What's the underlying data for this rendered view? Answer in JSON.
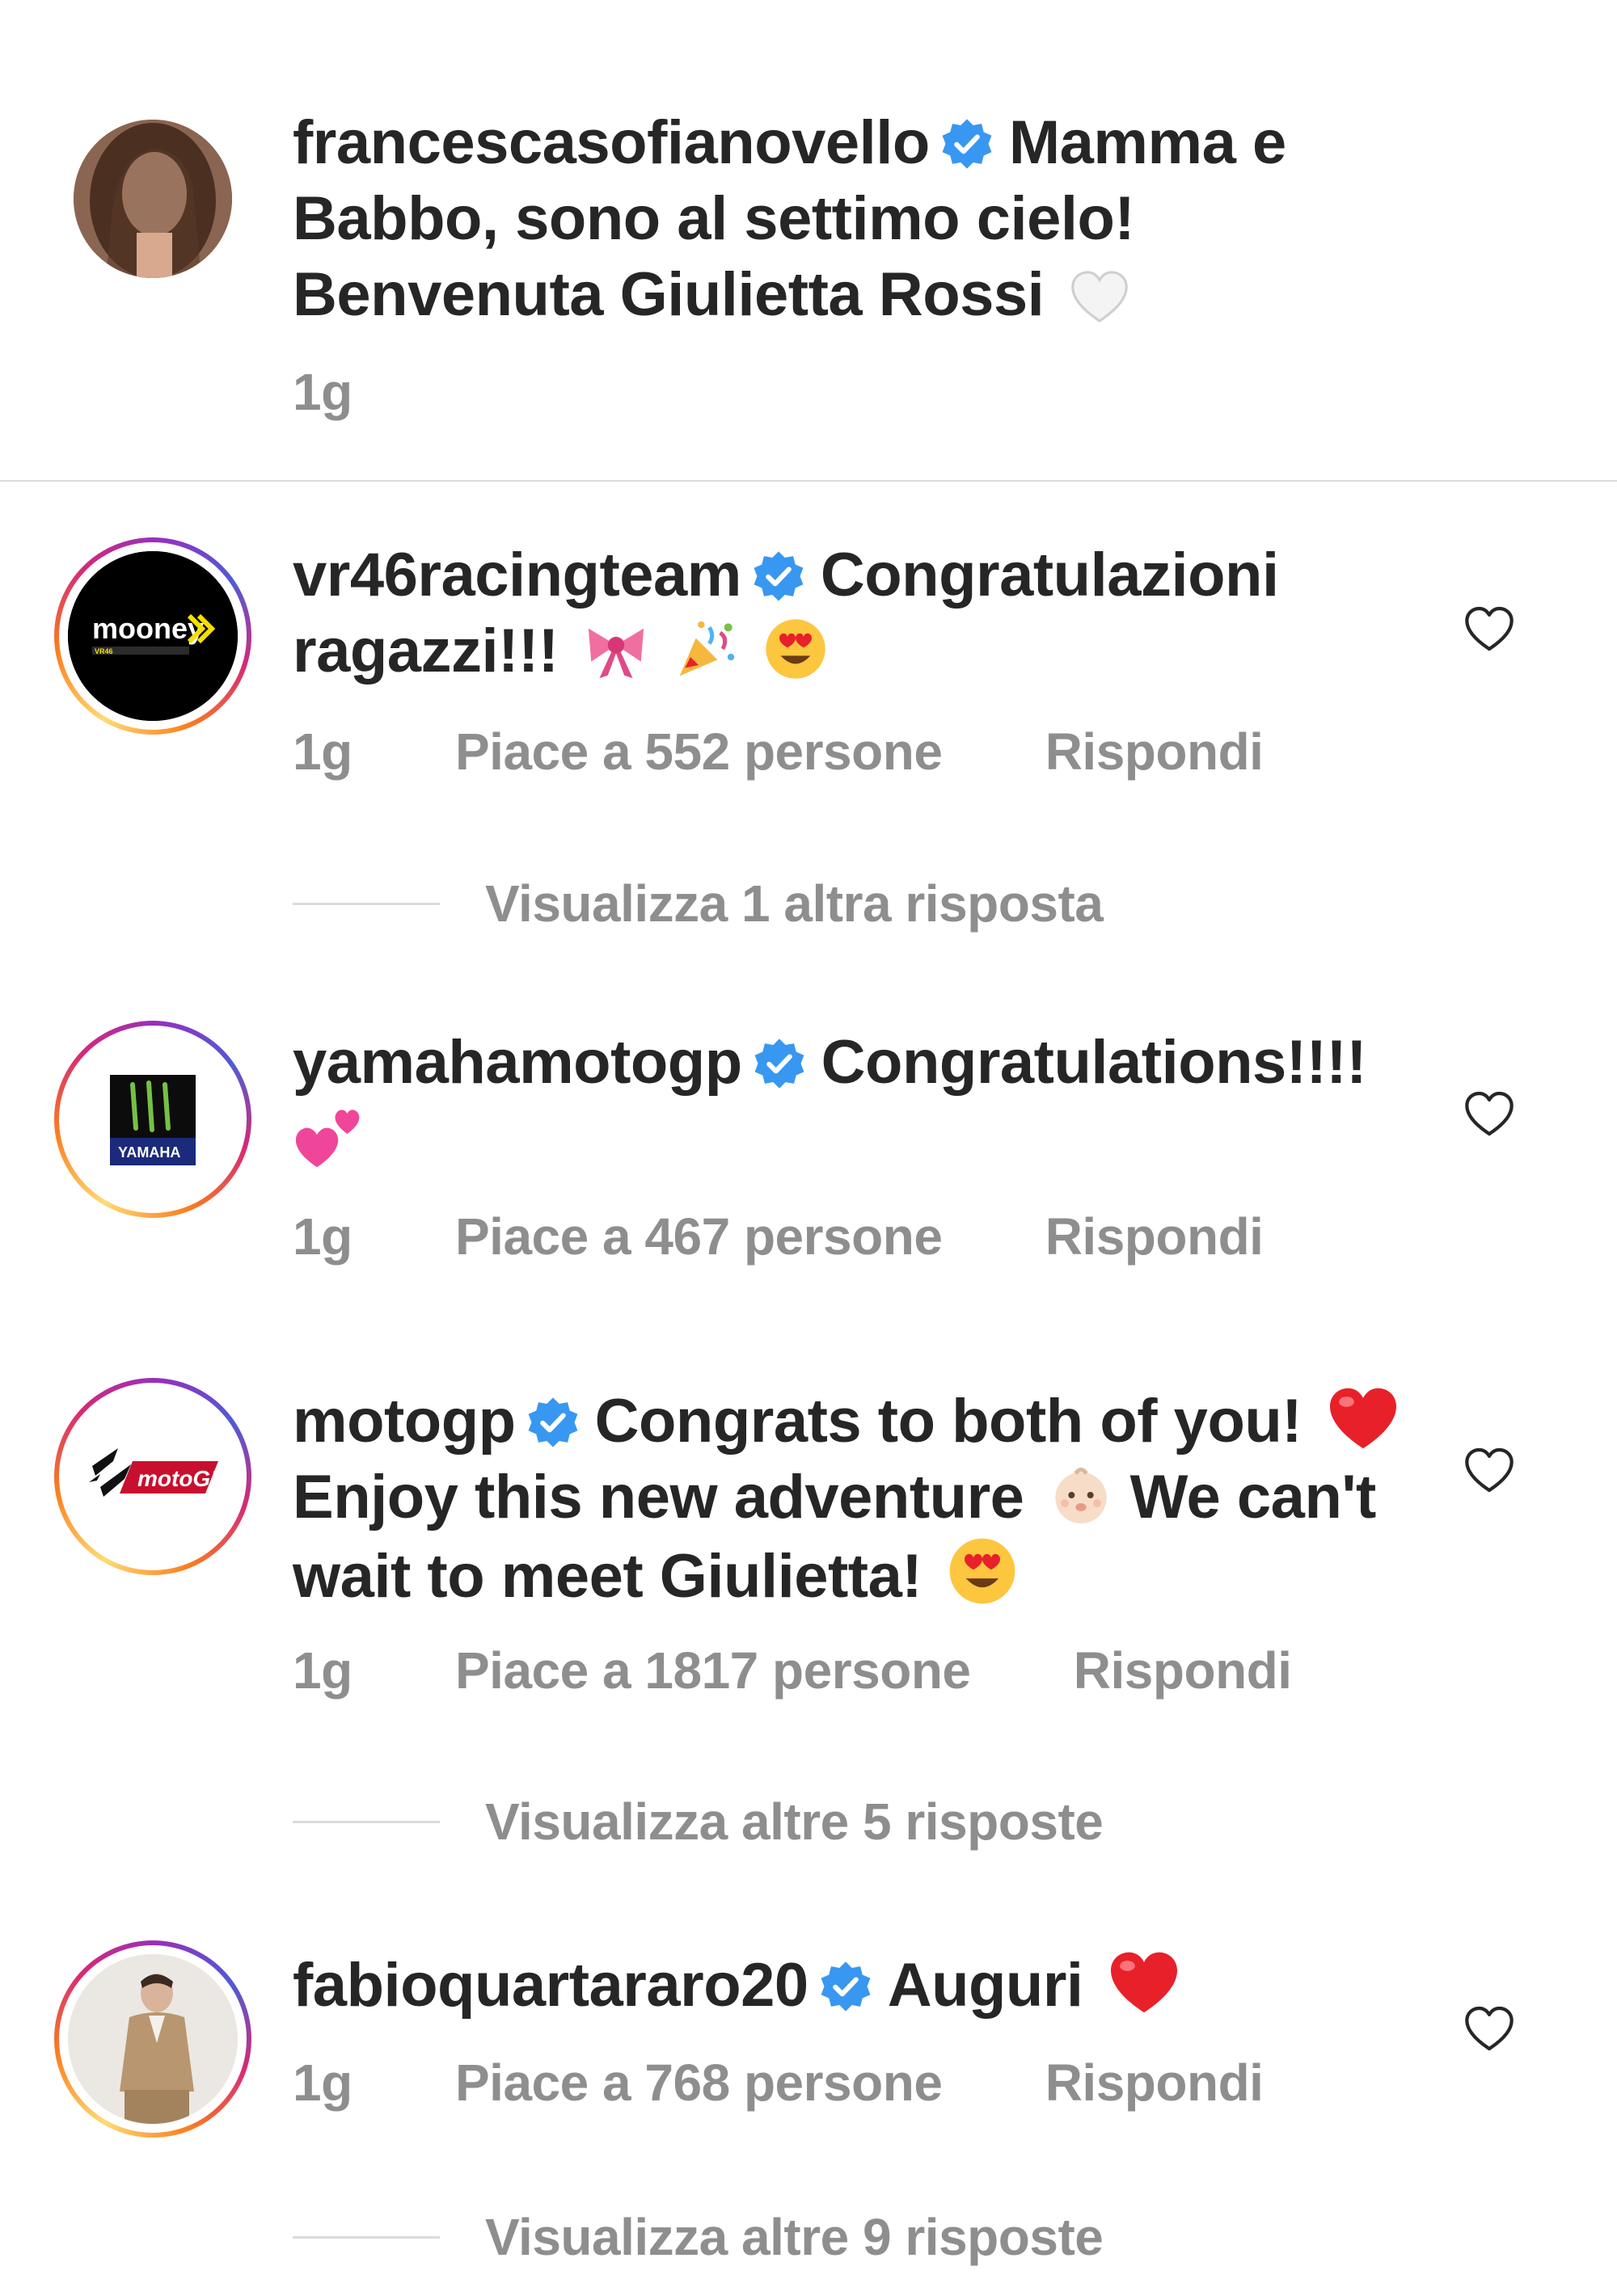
{
  "caption": {
    "username": "francescasofianovello",
    "text": "Mamma e Babbo, sono al settimo cielo! Benvenuta Giulietta Rossi",
    "time": "1g"
  },
  "comments": [
    {
      "username": "vr46racingteam",
      "text": "Congratulazioni ragazzi!!!",
      "time": "1g",
      "likes": "Piace a 552 persone",
      "reply": "Rispondi",
      "avatar_brand": "mooney",
      "avatar_sub": "VR46",
      "view_replies": "Visualizza 1 altra risposta"
    },
    {
      "username": "yamahamotogp",
      "text": "Congratulations!!!!",
      "time": "1g",
      "likes": "Piace a 467 persone",
      "reply": "Rispondi",
      "avatar_brand": "YAMAHA"
    },
    {
      "username": "motogp",
      "text1": "Congrats to both of you!",
      "text2": "Enjoy this new adventure",
      "text3": "We can't",
      "text4": "wait to meet Giulietta!",
      "time": "1g",
      "likes": "Piace a 1817 persone",
      "reply": "Rispondi",
      "avatar_brand": "motoGP",
      "view_replies": "Visualizza altre 5 risposte"
    },
    {
      "username": "fabioquartararo20",
      "text": "Auguri",
      "time": "1g",
      "likes": "Piace a 768 persone",
      "reply": "Rispondi",
      "view_replies": "Visualizza altre 9 risposte"
    }
  ],
  "colors": {
    "verified": "#3897f0",
    "meta_gray": "#8e8e8e",
    "heart_red": "#e8202a"
  },
  "icons": [
    "verified-badge-icon",
    "heart-outline-icon",
    "white-heart-emoji",
    "ribbon-emoji",
    "party-popper-emoji",
    "heart-eyes-emoji",
    "two-hearts-emoji",
    "red-heart-emoji",
    "baby-emoji"
  ]
}
